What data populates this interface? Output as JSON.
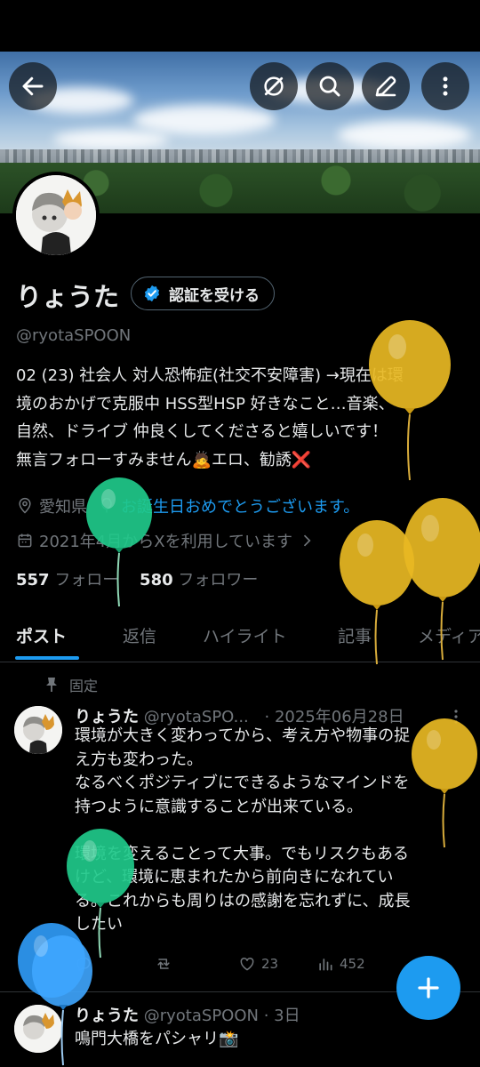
{
  "header": {
    "back_icon": "arrow-left-icon",
    "grok_icon": "slash-circle-icon",
    "search_icon": "search-icon",
    "compose_icon": "pencil-icon",
    "more_icon": "more-vertical-icon"
  },
  "profile": {
    "name": "りょうた",
    "verify_label": "認証を受ける",
    "handle": "@ryotaSPOON",
    "bio": [
      "02 (23) 社会人 対人恐怖症(社交不安障害) →現在は環",
      "境のおかげで克服中 HSS型HSP 好きなこと…音楽、",
      "自然、ドライブ 仲良くしてくださると嬉しいです！",
      "無言フォローすみません🙇エロ、勧誘❌"
    ],
    "location": "愛知県",
    "birthday_text": "お誕生日おめでとうございます。",
    "joined": "2021年4月からXを利用しています",
    "following_count": "557",
    "following_label": "フォロー",
    "followers_count": "580",
    "followers_label": "フォロワー"
  },
  "tabs": [
    "ポスト",
    "返信",
    "ハイライト",
    "記事",
    "メディア"
  ],
  "pinned_label": "固定",
  "post1": {
    "name": "りょうた",
    "handle": "@ryotaSPO...",
    "date": "· 2025年06月28日",
    "lines": [
      "環境が大きく変わってから、考え方や物事の捉",
      "え方も変わった。",
      "なるべくポジティブにできるようなマインドを",
      "持つように意識することが出来ている。",
      "",
      "環境を変えることって大事。でもリスクもある",
      "けど、環境に恵まれたから前向きになれてい",
      "る。これからも周りはの感謝を忘れずに、成長",
      "したい"
    ],
    "likes": "23",
    "views": "452"
  },
  "post2": {
    "name": "りょうた",
    "handle": "@ryotaSPOON",
    "date": "· 3日",
    "text": "鳴門大橋をパシャリ📸"
  },
  "colors": {
    "accent": "#1d9bf0",
    "muted": "#71767b",
    "text": "#e7e9ea",
    "balloon_yellow": "#e8b923",
    "balloon_green": "#1fc98a",
    "balloon_blue": "#2f9af5"
  }
}
